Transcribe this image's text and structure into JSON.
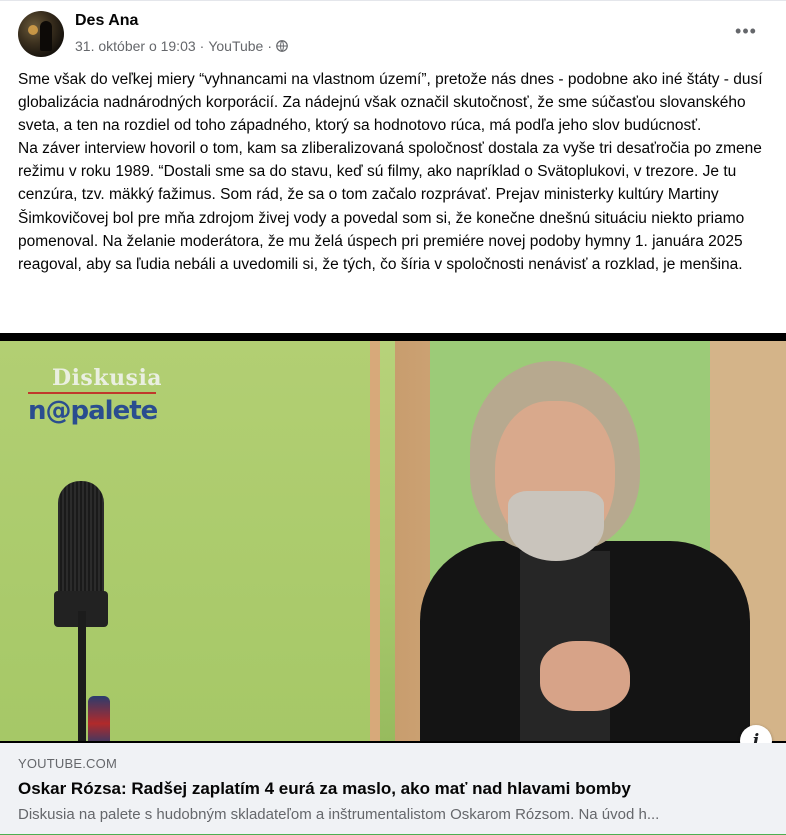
{
  "post": {
    "author": "Des Ana",
    "timestamp": "31. október o 19:03",
    "separator1": "·",
    "source": "YouTube",
    "separator2": "·",
    "privacy_icon": "globe-icon",
    "more_icon": "more-options-icon",
    "more_label": "•••",
    "paragraphs": [
      "Sme však do veľkej miery “vyhnancami na vlastnom území”, pretože nás dnes - podobne ako iné štáty - dusí globalizácia nadnárodných korporácií. Za nádejnú však označil skutočnosť, že sme súčasťou slovanského sveta, a ten na rozdiel od toho západného, ktorý sa hodnotovo rúca, má podľa jeho slov budúcnosť.",
      "Na záver interview hovoril o tom, kam sa zliberalizovaná spoločnosť dostala za vyše tri desaťročia po zmene režimu v roku 1989. “Dostali sme sa do stavu, keď sú filmy, ako napríklad o Svätoplukovi, v trezore. Je tu cenzúra, tzv. mäkký fažimus. Som rád, že sa o tom začalo rozprávať. Prejav ministerky kultúry Martiny Šimkovičovej bol pre mňa zdrojom živej vody a povedal som si, že konečne dnešnú situáciu niekto priamo pomenoval. Na želanie moderátora, že mu želá úspech pri premiére novej podoby hymny 1. januára 2025 reagoval, aby sa ľudia nebáli a uvedomili si, že tých, čo šíria v spoločnosti nenávisť a rozklad, je menšina."
    ]
  },
  "video": {
    "overlay_logo_line1": "Diskusia",
    "overlay_logo_line2": "n@palete",
    "info_label": "i"
  },
  "link_card": {
    "domain": "YOUTUBE.COM",
    "title": "Oskar Rózsa: Radšej zaplatím 4 eurá za maslo, ako mať nad hlavami bomby",
    "description": "Diskusia na palete s hudobným skladateľom a inštrumentalistom Oskarom Rózsom. Na úvod h..."
  }
}
